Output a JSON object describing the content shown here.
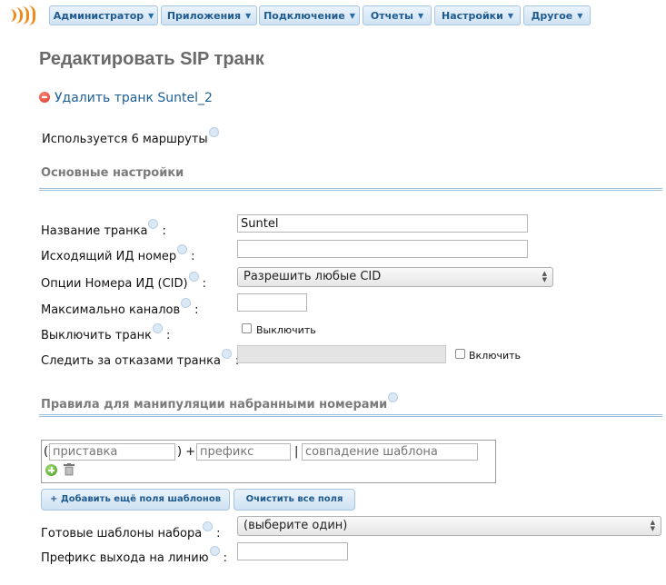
{
  "nav": {
    "items": [
      {
        "label": "Администратор"
      },
      {
        "label": "Приложения"
      },
      {
        "label": "Подключение"
      },
      {
        "label": "Отчеты"
      },
      {
        "label": "Настройки"
      },
      {
        "label": "Другое"
      }
    ]
  },
  "page": {
    "title": "Редактировать SIP транк",
    "delete_link": "Удалить транк Suntel_2",
    "used_by": "Используется 6 маршруты"
  },
  "general": {
    "section_title": "Основные настройки",
    "trunk_name": {
      "label": "Название транка",
      "value": "Suntel"
    },
    "outbound_cid": {
      "label": "Исходящий ИД номер",
      "value": ""
    },
    "cid_options": {
      "label": "Опции Номера ИД (CID)",
      "selected": "Разрешить любые CID"
    },
    "max_channels": {
      "label": "Максимально каналов",
      "value": ""
    },
    "disable_trunk": {
      "label": "Выключить транк",
      "checkbox_label": "Выключить",
      "checked": false
    },
    "monitor_failures": {
      "label": "Следить за отказами транка",
      "value": "",
      "checkbox_label": "Включить",
      "checked": false
    }
  },
  "dial_rules": {
    "section_title": "Правила для манипуляции набранными номерами",
    "prepend_placeholder": "приставка",
    "prefix_placeholder": "префикс",
    "pattern_placeholder": "совпадение шаблона",
    "open_paren": "(",
    "close_paren_plus": ") +",
    "pipe": "|",
    "add_fields_button": "+ Добавить ещё поля шаблонов",
    "clear_fields_button": "Очистить все поля",
    "templates": {
      "label": "Готовые шаблоны набора",
      "selected": "(выберите один)"
    },
    "outbound_prefix": {
      "label": "Префикс выхода на линию",
      "value": ""
    }
  },
  "colors": {
    "nav_text": "#1f5a8e",
    "link": "#1c5e94",
    "section_title": "#7b7b7b",
    "section_line": "#9fc0dd",
    "logo": "#f08a16"
  }
}
